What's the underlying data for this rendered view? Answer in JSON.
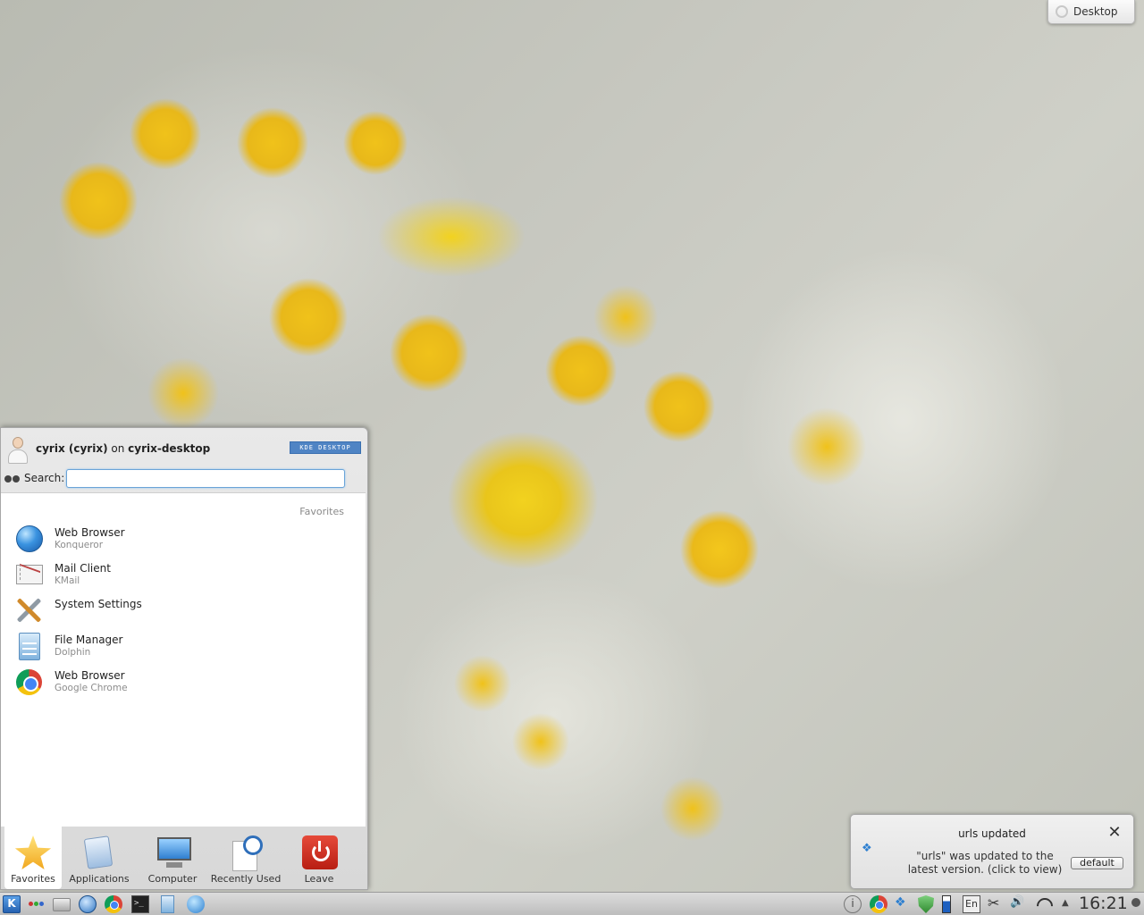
{
  "desktop_toolbox": {
    "label": "Desktop"
  },
  "kickoff": {
    "user": {
      "name": "cyrix (cyrix)",
      "on": " on ",
      "host": "cyrix-desktop"
    },
    "badge": "KDE DESKTOP",
    "search": {
      "label": "Search:",
      "value": "",
      "placeholder": ""
    },
    "section_title": "Favorites",
    "favorites": [
      {
        "name": "Web Browser",
        "sub": "Konqueror",
        "icon": "globe-icon"
      },
      {
        "name": "Mail Client",
        "sub": "KMail",
        "icon": "mail-icon"
      },
      {
        "name": "System Settings",
        "sub": "",
        "icon": "tools-icon"
      },
      {
        "name": "File Manager",
        "sub": "Dolphin",
        "icon": "file-manager-icon"
      },
      {
        "name": "Web Browser",
        "sub": "Google Chrome",
        "icon": "chrome-icon"
      }
    ],
    "tabs": [
      {
        "label": "Favorites",
        "icon": "star-icon",
        "active": true
      },
      {
        "label": "Applications",
        "icon": "applications-icon"
      },
      {
        "label": "Computer",
        "icon": "computer-icon"
      },
      {
        "label": "Recently Used",
        "icon": "recently-used-icon"
      },
      {
        "label": "Leave",
        "icon": "leave-icon"
      }
    ]
  },
  "notification": {
    "title": "urls updated",
    "body": "\"urls\" was updated to the latest version. (click to view)",
    "action": "default",
    "close": "✕"
  },
  "panel": {
    "keyboard_layout": "En",
    "clock": "16:21"
  },
  "colors": {
    "accent": "#6aa4d8",
    "panel": "#cfcfcf"
  }
}
